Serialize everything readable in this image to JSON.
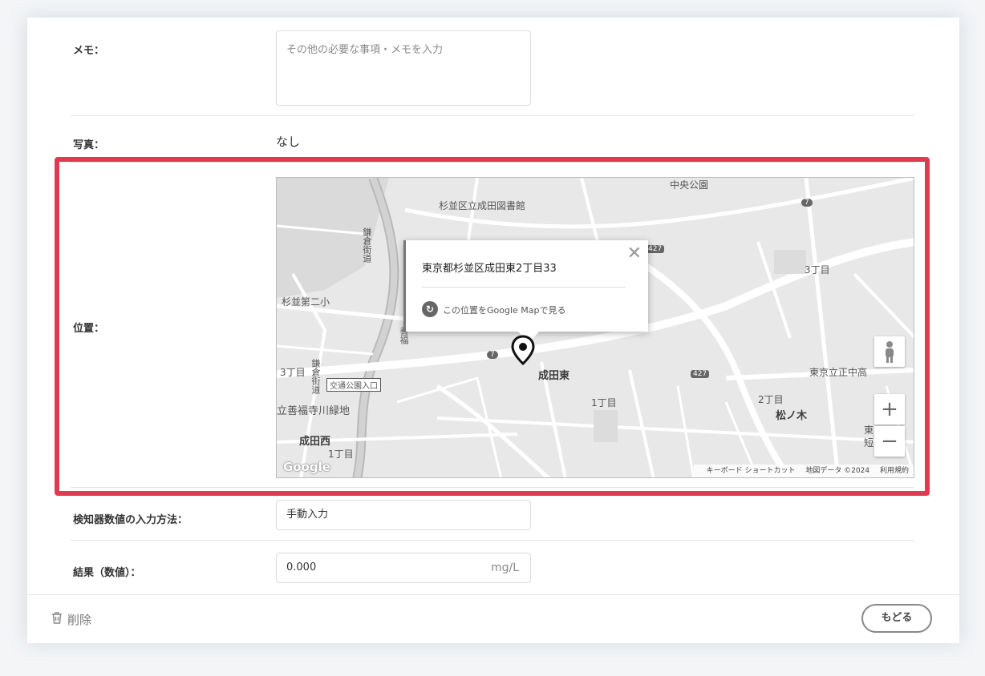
{
  "form": {
    "memo": {
      "label": "メモ：",
      "placeholder": "その他の必要な事項・メモを入力"
    },
    "photo": {
      "label": "写真：",
      "value": "なし"
    },
    "location": {
      "label": "位置：",
      "map": {
        "popup_address": "東京都杉並区成田東2丁目33",
        "popup_link": "この位置をGoogle Mapで見る",
        "labels": {
          "chuo_park": "中央公園",
          "library": "杉並区立成田図書館",
          "kamakura_road_1": "鎌倉街道",
          "kamakura_road_2": "鎌倉街道",
          "suginami_2nd": "杉並第二小",
          "zenpuku": "善福",
          "chome3_left": "3丁目",
          "kotsu_koen": "交通公園入口",
          "zenpukuji_green": "立善福寺川緑地",
          "narita_nishi": "成田西",
          "chome1_left": "1丁目",
          "narita_higashi": "成田東",
          "chome1_mid": "1丁目",
          "chome2": "2丁目",
          "matsunoki": "松ノ木",
          "chome3_right": "3丁目",
          "tokyo_seichu": "東京立正中高",
          "higashi_frag": "東",
          "tan_frag": "短",
          "route_427_a": "427",
          "route_427_b": "427",
          "route_7_a": "7",
          "route_7_b": "7"
        },
        "attribution": {
          "shortcuts": "キーボード ショートカット",
          "data": "地図データ ©2024",
          "terms": "利用規約"
        },
        "logo": "Google",
        "zoom_in": "+",
        "zoom_out": "−",
        "close": "✕"
      }
    },
    "detector_input": {
      "label": "検知器数値の入力方法：",
      "value": "手動入力"
    },
    "result": {
      "label": "結果（数値）：",
      "value": "0.000",
      "unit": "mg/L"
    }
  },
  "footer": {
    "delete_label": "削除",
    "back_label": "もどる"
  },
  "colors": {
    "highlight": "#e03a52"
  }
}
